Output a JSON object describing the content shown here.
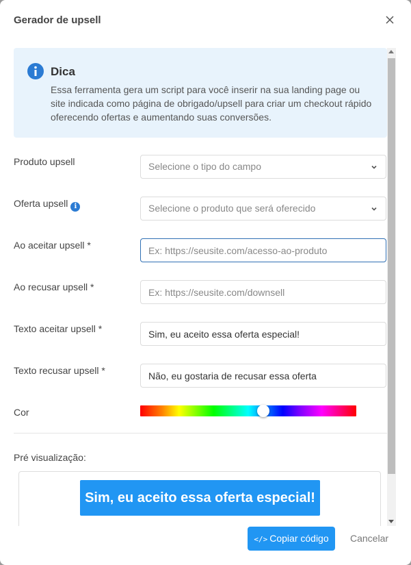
{
  "modal": {
    "title": "Gerador de upsell"
  },
  "tip": {
    "title": "Dica",
    "text": "Essa ferramenta gera um script para você inserir na sua landing page ou site indicada como página de obrigado/upsell para criar um checkout rápido oferecendo ofertas e aumentando suas conversões."
  },
  "form": {
    "produto_upsell": {
      "label": "Produto upsell",
      "placeholder": "Selecione o tipo do campo"
    },
    "oferta_upsell": {
      "label": "Oferta upsell",
      "placeholder": "Selecione o produto que será oferecido"
    },
    "ao_aceitar": {
      "label": "Ao aceitar upsell *",
      "placeholder": "Ex: https://seusite.com/acesso-ao-produto"
    },
    "ao_recusar": {
      "label": "Ao recusar upsell *",
      "placeholder": "Ex: https://seusite.com/downsell"
    },
    "texto_aceitar": {
      "label": "Texto aceitar upsell *",
      "value": "Sim, eu aceito essa oferta especial!"
    },
    "texto_recusar": {
      "label": "Texto recusar upsell *",
      "value": "Não, eu gostaria de recusar essa oferta"
    },
    "cor": {
      "label": "Cor",
      "hue_fraction": 0.57
    }
  },
  "preview": {
    "label": "Pré visualização:",
    "button_text": "Sim, eu aceito essa oferta especial!",
    "button_color": "#2196f3"
  },
  "footer": {
    "copy_label": "Copiar código",
    "copy_icon": "code-icon",
    "cancel_label": "Cancelar"
  },
  "colors": {
    "accent": "#2196f3",
    "tip_bg": "#e8f3fc",
    "info_icon": "#2b7bd3"
  }
}
